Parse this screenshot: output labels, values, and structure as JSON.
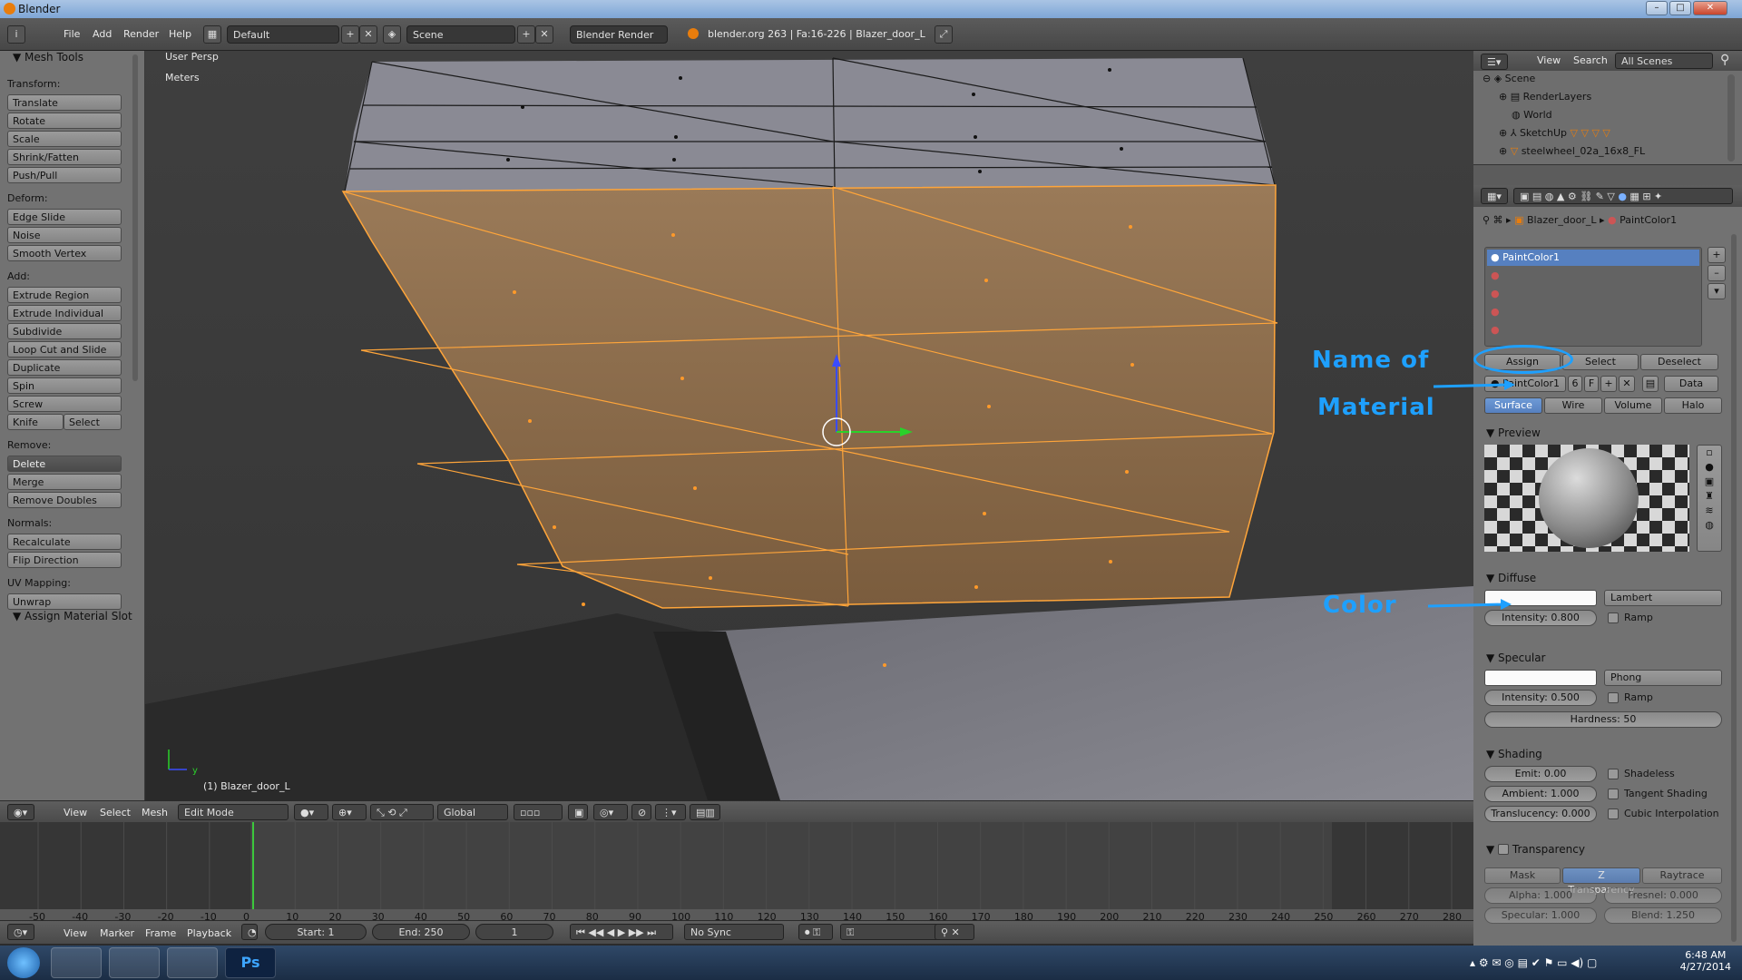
{
  "window": {
    "title": "Blender"
  },
  "info_header": {
    "menus": [
      "File",
      "Add",
      "Render",
      "Help"
    ],
    "layout": "Default",
    "scene": "Scene",
    "engine": "Blender Render",
    "stats": "blender.org 263 | Fa:16-226 | Blazer_door_L"
  },
  "tool_shelf": {
    "title": "Mesh Tools",
    "transform_label": "Transform:",
    "transform": [
      "Translate",
      "Rotate",
      "Scale",
      "Shrink/Fatten",
      "Push/Pull"
    ],
    "deform_label": "Deform:",
    "deform": [
      "Edge Slide",
      "Noise",
      "Smooth Vertex"
    ],
    "add_label": "Add:",
    "add": [
      "Extrude Region",
      "Extrude Individual",
      "Subdivide",
      "Loop Cut and Slide",
      "Duplicate",
      "Spin",
      "Screw"
    ],
    "knife": "Knife",
    "select": "Select",
    "remove_label": "Remove:",
    "delete": "Delete",
    "remove": [
      "Merge",
      "Remove Doubles"
    ],
    "normals_label": "Normals:",
    "normals": [
      "Recalculate",
      "Flip Direction"
    ],
    "uv_label": "UV Mapping:",
    "unwrap": "Unwrap",
    "assign_slot": "Assign Material Slot"
  },
  "viewport": {
    "view_name": "User Persp",
    "units": "Meters",
    "object_label": "(1) Blazer_door_L",
    "axis_y": "y"
  },
  "viewport_header": {
    "menus": [
      "View",
      "Select",
      "Mesh"
    ],
    "mode": "Edit Mode",
    "orientation": "Global"
  },
  "timeline": {
    "ticks": [
      -50,
      -40,
      -30,
      -20,
      -10,
      0,
      10,
      20,
      30,
      40,
      50,
      60,
      70,
      80,
      90,
      100,
      110,
      120,
      130,
      140,
      150,
      160,
      170,
      180,
      190,
      200,
      210,
      220,
      230,
      240,
      250,
      260,
      270,
      280
    ],
    "menus": [
      "View",
      "Marker",
      "Frame",
      "Playback"
    ],
    "start": "Start: 1",
    "end": "End: 250",
    "current": "1",
    "sync": "No Sync"
  },
  "outliner": {
    "menus": [
      "View",
      "Search"
    ],
    "filter": "All Scenes",
    "items": [
      "Scene",
      "RenderLayers",
      "World",
      "SketchUp",
      "steelwheel_02a_16x8_FL"
    ]
  },
  "properties": {
    "breadcrumb_object": "Blazer_door_L",
    "breadcrumb_material": "PaintColor1",
    "slot_selected": "PaintColor1",
    "assign": "Assign",
    "select": "Select",
    "deselect": "Deselect",
    "material_name": "PaintColor1",
    "users": "6",
    "fake": "F",
    "link": "Data",
    "tabs": [
      "Surface",
      "Wire",
      "Volume",
      "Halo"
    ],
    "preview_label": "Preview",
    "diffuse_label": "Diffuse",
    "diffuse_shader": "Lambert",
    "diffuse_intensity": "Intensity: 0.800",
    "ramp": "Ramp",
    "specular_label": "Specular",
    "specular_shader": "Phong",
    "specular_intensity": "Intensity: 0.500",
    "hardness": "Hardness: 50",
    "shading_label": "Shading",
    "emit": "Emit: 0.00",
    "ambient": "Ambient: 1.000",
    "translucency": "Translucency: 0.000",
    "shadeless": "Shadeless",
    "tangent": "Tangent Shading",
    "cubic": "Cubic Interpolation",
    "transparency_label": "Transparency",
    "trans_tabs": [
      "Mask",
      "Z Transparency",
      "Raytrace"
    ],
    "alpha": "Alpha: 1.000",
    "fresnel": "Fresnel: 0.000",
    "specular_t": "Specular: 1.000",
    "blend": "Blend: 1.250"
  },
  "annotations": {
    "name_line1": "Name of",
    "name_line2": "Material",
    "color": "Color",
    "color_hex": "#1ea0ff"
  },
  "taskbar": {
    "time": "6:48 AM",
    "date": "4/27/2014",
    "ps_label": "Ps"
  }
}
